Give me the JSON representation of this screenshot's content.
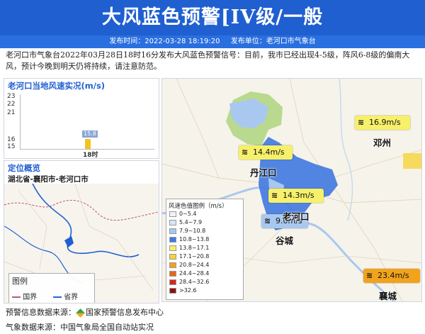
{
  "header": {
    "title": "大风蓝色预警[IV级/一般",
    "publish_time": "发布时间：2022-03-28 18:19:20",
    "publisher": "发布单位：老河口市气象台"
  },
  "description": "老河口市气象台2022年03月28日18时16分发布大风蓝色预警信号：目前，我市已经出现4-5级，阵风6-8级的偏南大风，预计今晚到明天仍将持续，请注意防范。",
  "wind_panel": {
    "title": "老河口当地风速实况(m/s)",
    "yticks": [
      "23",
      "22",
      "21",
      "16",
      "15"
    ],
    "chart_data": {
      "type": "bar",
      "categories": [
        "18时"
      ],
      "values": [
        15.8
      ],
      "title": "老河口当地风速实况(m/s)",
      "xlabel": "",
      "ylabel": "",
      "value_labels": [
        "15.8"
      ],
      "bar_color": "#f2c320"
    }
  },
  "location_panel": {
    "title": "定位概览",
    "subtitle": "湖北省-襄阳市-老河口市",
    "legend_title": "图例",
    "legend_items": [
      {
        "label": "国界",
        "color": "#c0506a"
      },
      {
        "label": "省界",
        "color": "#1f5fd0"
      }
    ]
  },
  "main_map": {
    "legend_title": "风速色值图例（m/s）",
    "legend": [
      {
        "label": "0~5.4",
        "color": "#f2f2f2"
      },
      {
        "label": "5.4~7.9",
        "color": "#d6e6f8"
      },
      {
        "label": "7.9~10.8",
        "color": "#a9c8ef"
      },
      {
        "label": "10.8~13.8",
        "color": "#3f79e0"
      },
      {
        "label": "13.8~17.1",
        "color": "#f7f06a"
      },
      {
        "label": "17.1~20.8",
        "color": "#f7d33a"
      },
      {
        "label": "20.8~24.4",
        "color": "#f2a31c"
      },
      {
        "label": "24.4~28.4",
        "color": "#e8661a"
      },
      {
        "label": "28.4~32.6",
        "color": "#d3281f"
      },
      {
        "label": ">32.6",
        "color": "#8f0f0f"
      }
    ],
    "wind_tags": [
      {
        "value": "16.9m/s",
        "color": "#f7f06a"
      },
      {
        "value": "14.4m/s",
        "color": "#f7f06a"
      },
      {
        "value": "14.3m/s",
        "color": "#f7f06a"
      },
      {
        "value": "9.0m/s",
        "color": "#a9c8ef"
      },
      {
        "value": "23.4m/s",
        "color": "#f2a31c"
      }
    ],
    "cities": [
      "邓州",
      "丹江口",
      "老河口",
      "谷城",
      "襄城"
    ]
  },
  "footer": {
    "warning_source": "预警信息数据来源：",
    "warning_source_name": "国家预警信息发布中心",
    "weather_source": "气象数据来源：中国气象局全国自动站实况"
  }
}
